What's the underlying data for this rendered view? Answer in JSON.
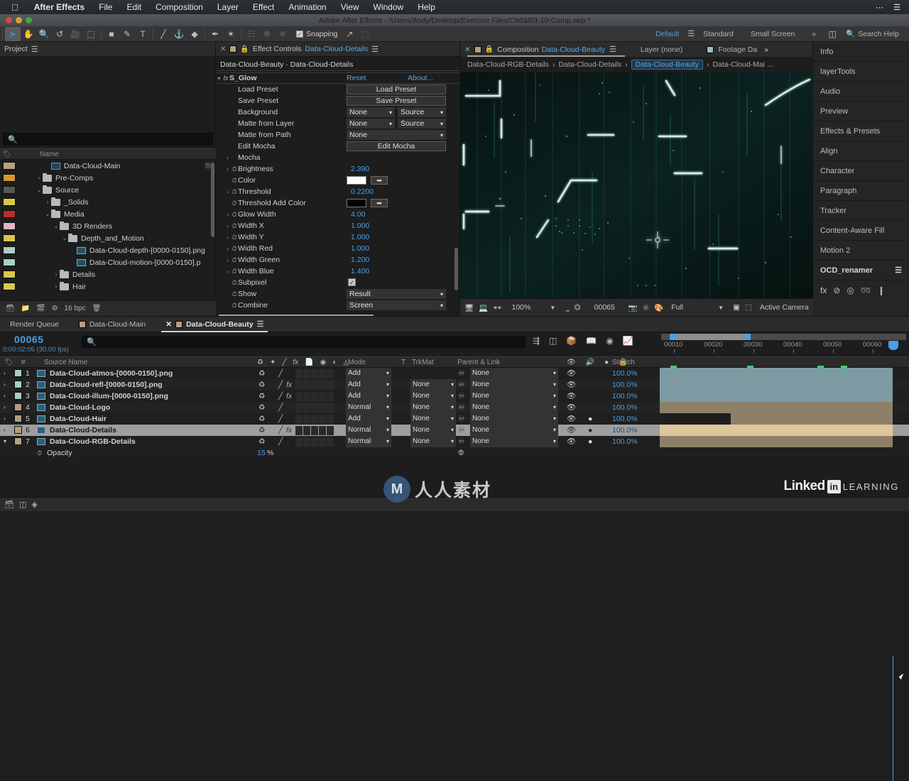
{
  "menubar": {
    "apple_icon": "apple-icon",
    "items": [
      "After Effects",
      "File",
      "Edit",
      "Composition",
      "Layer",
      "Effect",
      "Animation",
      "View",
      "Window",
      "Help"
    ],
    "right_icons": [
      "ellipsis-icon",
      "list-icon"
    ]
  },
  "titlebar": {
    "title": "Adobe After Effects - /Users/Andy/Desktop/Exercise Files/Ch03/03-10-Comp.aep *"
  },
  "toolbar": {
    "tools": [
      {
        "name": "selection-tool",
        "glyph": "➤",
        "selected": true
      },
      {
        "name": "hand-tool",
        "glyph": "✋",
        "selected": false
      },
      {
        "name": "zoom-tool",
        "glyph": "🔍",
        "selected": false
      },
      {
        "name": "rotation-tool",
        "glyph": "↺",
        "selected": false
      },
      {
        "name": "camera-tool",
        "glyph": "🎥",
        "selected": false
      },
      {
        "name": "pan-behind-tool",
        "glyph": "⬚",
        "selected": false
      },
      {
        "name": "shape-tool",
        "glyph": "■",
        "selected": false
      },
      {
        "name": "pen-tool",
        "glyph": "✒",
        "selected": false
      },
      {
        "name": "type-tool",
        "glyph": "T",
        "selected": false
      },
      {
        "name": "brush-tool",
        "glyph": "╱",
        "selected": false
      },
      {
        "name": "clone-stamp-tool",
        "glyph": "⚓",
        "selected": false
      },
      {
        "name": "eraser-tool",
        "glyph": "◆",
        "selected": false
      },
      {
        "name": "roto-brush-tool",
        "glyph": "✎",
        "selected": false
      },
      {
        "name": "puppet-pin-tool",
        "glyph": "✦",
        "selected": false
      },
      {
        "name": "puppet-overlap-tool",
        "glyph": "☷",
        "selected": false,
        "dim": true
      },
      {
        "name": "puppet-starch-tool",
        "glyph": "☸",
        "selected": false,
        "dim": true
      },
      {
        "name": "puppet-advanced-tool",
        "glyph": "✵",
        "selected": false,
        "dim": true
      }
    ],
    "snapping_label": "Snapping",
    "snapping_checked": true,
    "extra_icons": [
      "snap-align-icon",
      "snap-grid-icon"
    ]
  },
  "workspace": {
    "items": [
      "Default",
      "Standard",
      "Small Screen"
    ],
    "active": "Default",
    "overflow_glyph": "»",
    "layout_icon": "workspace-layout-icon",
    "search_icon": "search-icon",
    "search_help": "Search Help"
  },
  "project": {
    "tab_title": "Project",
    "search_placeholder": "",
    "columns": [
      "Name"
    ],
    "tree": [
      {
        "label": "Data-Cloud-Main",
        "indent": 2,
        "type": "comp",
        "color": "#b6a07c",
        "arrow": "",
        "expanded": false
      },
      {
        "label": "Pre-Comps",
        "indent": 1,
        "type": "folder",
        "color": "#d79633",
        "arrow": "›",
        "expanded": false
      },
      {
        "label": "Source",
        "indent": 1,
        "type": "folder",
        "color": "#585858",
        "arrow": "⌄",
        "expanded": true
      },
      {
        "label": "_Solids",
        "indent": 2,
        "type": "folder",
        "color": "#d8c84a",
        "arrow": "›",
        "expanded": false
      },
      {
        "label": "Media",
        "indent": 2,
        "type": "folder",
        "color": "#bb2c2c",
        "arrow": "⌄",
        "expanded": true
      },
      {
        "label": "3D Renders",
        "indent": 3,
        "type": "folder",
        "color": "#e2b3c4",
        "arrow": "⌄",
        "expanded": true
      },
      {
        "label": "Depth_and_Motion",
        "indent": 4,
        "type": "folder",
        "color": "#d8c84a",
        "arrow": "⌄",
        "expanded": true
      },
      {
        "label": "Data-Cloud-depth-[0000-0150].png",
        "indent": 5,
        "type": "media",
        "color": "#a8cfc6",
        "arrow": "",
        "expanded": false
      },
      {
        "label": "Data-Cloud-motion-[0000-0150].p",
        "indent": 5,
        "type": "media",
        "color": "#a8cfc6",
        "arrow": "",
        "expanded": false
      },
      {
        "label": "Details",
        "indent": 3,
        "type": "folder",
        "color": "#d8c84a",
        "arrow": "›",
        "expanded": false
      },
      {
        "label": "Hair",
        "indent": 3,
        "type": "folder",
        "color": "#d8c84a",
        "arrow": "›",
        "expanded": false
      }
    ],
    "footer": {
      "bpc": "16 bpc",
      "icons": [
        "new-comp-icon",
        "new-folder-icon",
        "footage-icon",
        "project-settings-icon",
        "delete-icon"
      ]
    }
  },
  "effect_controls": {
    "tab_title": "Effect Controls",
    "tab_target": "Data-Cloud-Details",
    "breadcrumb": "Data-Cloud-Beauty · Data-Cloud-Details",
    "effect_name": "S_Glow",
    "reset_label": "Reset",
    "about_label": "About...",
    "params": [
      {
        "name": "Load Preset",
        "type": "button",
        "value": "Load Preset"
      },
      {
        "name": "Save Preset",
        "type": "button",
        "value": "Save Preset"
      },
      {
        "name": "Background",
        "type": "dualdrop",
        "value": "None",
        "value2": "Source"
      },
      {
        "name": "Matte from Layer",
        "type": "dualdrop",
        "value": "None",
        "value2": "Source"
      },
      {
        "name": "Matte from Path",
        "type": "drop",
        "value": "None"
      },
      {
        "name": "Edit Mocha",
        "type": "button",
        "value": "Edit Mocha"
      },
      {
        "name": "Mocha",
        "type": "group",
        "value": ""
      },
      {
        "name": "Brightness",
        "type": "num",
        "value": "2.390"
      },
      {
        "name": "Color",
        "type": "color",
        "value": "#ffffff"
      },
      {
        "name": "Threshold",
        "type": "num",
        "value": "0.2200"
      },
      {
        "name": "Threshold Add Color",
        "type": "color",
        "value": "#000000"
      },
      {
        "name": "Glow Width",
        "type": "num",
        "value": "4.00"
      },
      {
        "name": "Width X",
        "type": "num",
        "value": "1.000"
      },
      {
        "name": "Width Y",
        "type": "num",
        "value": "1.000"
      },
      {
        "name": "Width Red",
        "type": "num",
        "value": "1.000"
      },
      {
        "name": "Width Green",
        "type": "num",
        "value": "1.200"
      },
      {
        "name": "Width Blue",
        "type": "num",
        "value": "1.400"
      },
      {
        "name": "Subpixel",
        "type": "check",
        "value": "true"
      },
      {
        "name": "Show",
        "type": "drop",
        "value": "Result"
      },
      {
        "name": "Combine",
        "type": "drop",
        "value": "Screen"
      }
    ]
  },
  "composition": {
    "tab_title": "Composition",
    "tab_target": "Data-Cloud-Beauty",
    "other_tabs": [
      "Layer (none)",
      "Footage Da"
    ],
    "overflow_glyph": "»",
    "breadcrumbs": [
      "Data-Cloud-RGB-Details",
      "Data-Cloud-Details",
      "Data-Cloud-Beauty",
      "Data-Cloud-Mai …"
    ],
    "active_breadcrumb": "Data-Cloud-Beauty",
    "footer": {
      "zoom": "100%",
      "frame": "00065",
      "resolution": "Full",
      "view": "Active Camera",
      "icons": [
        "main-view-icon",
        "monitor-icon",
        "3d-glasses-icon",
        "region-of-interest-icon",
        "transparency-grid-icon",
        "snapshot-icon",
        "show-snapshot-icon",
        "channel-icon",
        "mask-icon",
        "toggle-view-icon"
      ]
    }
  },
  "dock": {
    "panels": [
      "Info",
      "layerTools",
      "Audio",
      "Preview",
      "Effects & Presets",
      "Align",
      "Character",
      "Paragraph",
      "Tracker",
      "Content-Aware Fill",
      "Motion 2"
    ],
    "active_panel": "OCD_renamer",
    "icons": [
      "fx-icon",
      "mask-icon",
      "spiral-icon",
      "puppet-icon",
      "more-icon"
    ]
  },
  "timeline": {
    "tabs": [
      {
        "label": "Render Queue",
        "active": false,
        "swatch": false,
        "closeable": false
      },
      {
        "label": "Data-Cloud-Main",
        "active": false,
        "swatch": true,
        "closeable": false
      },
      {
        "label": "Data-Cloud-Beauty",
        "active": true,
        "swatch": true,
        "closeable": true
      }
    ],
    "timecode": "00065",
    "timecode_sub": "0:00:02:05 (30.00 fps)",
    "search_placeholder": "",
    "toolbar_icons": [
      "composition-mini-flowchart-icon",
      "3d-renderer-icon",
      "draft-3d-icon",
      "hide-shy-icon",
      "frame-blending-icon",
      "motion-blur-icon",
      "graph-editor-icon"
    ],
    "ruler_labels": [
      "00010",
      "00020",
      "00030",
      "00040",
      "00050",
      "00060"
    ],
    "columns": [
      "#",
      "Source Name",
      "Mode",
      "T",
      "TrkMat",
      "Parent & Link",
      "Stretch"
    ],
    "layers": [
      {
        "num": "1",
        "name": "Data-Cloud-atmos-[0000-0150].png",
        "color": "#a8cfc6",
        "mode": "Add",
        "trkmat": "",
        "parent": "None",
        "stretch": "100.0%",
        "fx": false,
        "eye": true,
        "solo": false,
        "bar": "#7e9ba3",
        "barstart": 0
      },
      {
        "num": "2",
        "name": "Data-Cloud-refl-[0000-0150].png",
        "color": "#a8cfc6",
        "mode": "Add",
        "trkmat": "None",
        "parent": "None",
        "stretch": "100.0%",
        "fx": true,
        "eye": true,
        "solo": false,
        "bar": "#7e9ba3",
        "barstart": 0
      },
      {
        "num": "3",
        "name": "Data-Cloud-illum-[0000-0150].png",
        "color": "#a8cfc6",
        "mode": "Add",
        "trkmat": "None",
        "parent": "None",
        "stretch": "100.0%",
        "fx": true,
        "eye": true,
        "solo": false,
        "bar": "#7e9ba3",
        "barstart": 0
      },
      {
        "num": "4",
        "name": "Data-Cloud-Logo",
        "color": "#b6a07c",
        "mode": "Normal",
        "trkmat": "None",
        "parent": "None",
        "stretch": "100.0%",
        "fx": false,
        "eye": true,
        "solo": false,
        "bar": "#8e8068",
        "barstart": 0
      },
      {
        "num": "5",
        "name": "Data-Cloud-Hair",
        "color": "#b6a07c",
        "mode": "Add",
        "trkmat": "None",
        "parent": "None",
        "stretch": "100.0%",
        "fx": false,
        "eye": true,
        "solo": true,
        "bar": "#8e8068",
        "barstart": 100
      },
      {
        "num": "6",
        "name": "Data-Cloud-Details",
        "color": "#b6a07c",
        "mode": "Normal",
        "trkmat": "None",
        "parent": "None",
        "stretch": "100.0%",
        "fx": true,
        "eye": true,
        "solo": true,
        "bar": "#ddc79a",
        "barstart": 0,
        "selected": true
      },
      {
        "num": "7",
        "name": "Data-Cloud-RGB-Details",
        "color": "#b6a07c",
        "mode": "Normal",
        "trkmat": "None",
        "parent": "None",
        "stretch": "100.0%",
        "fx": false,
        "eye": true,
        "solo": true,
        "bar": "#8e8068",
        "barstart": 0,
        "expanded": true
      }
    ],
    "property_row": {
      "name": "Opacity",
      "value": "15",
      "unit": "%"
    },
    "footer_icons": [
      "toggle-switches-icon",
      "layer-switches-icon",
      "graph-icon"
    ]
  },
  "watermark": {
    "text": "人人素材",
    "mark": "M"
  },
  "branding": {
    "linked": "Linked",
    "in": "in",
    "learning": "LEARNING"
  },
  "colors": {
    "accent_blue": "#4a9fe8",
    "panel_bg": "#1d1d1d",
    "tab_bg": "#2b2b2b",
    "selected_row": "#9e9e9e"
  }
}
